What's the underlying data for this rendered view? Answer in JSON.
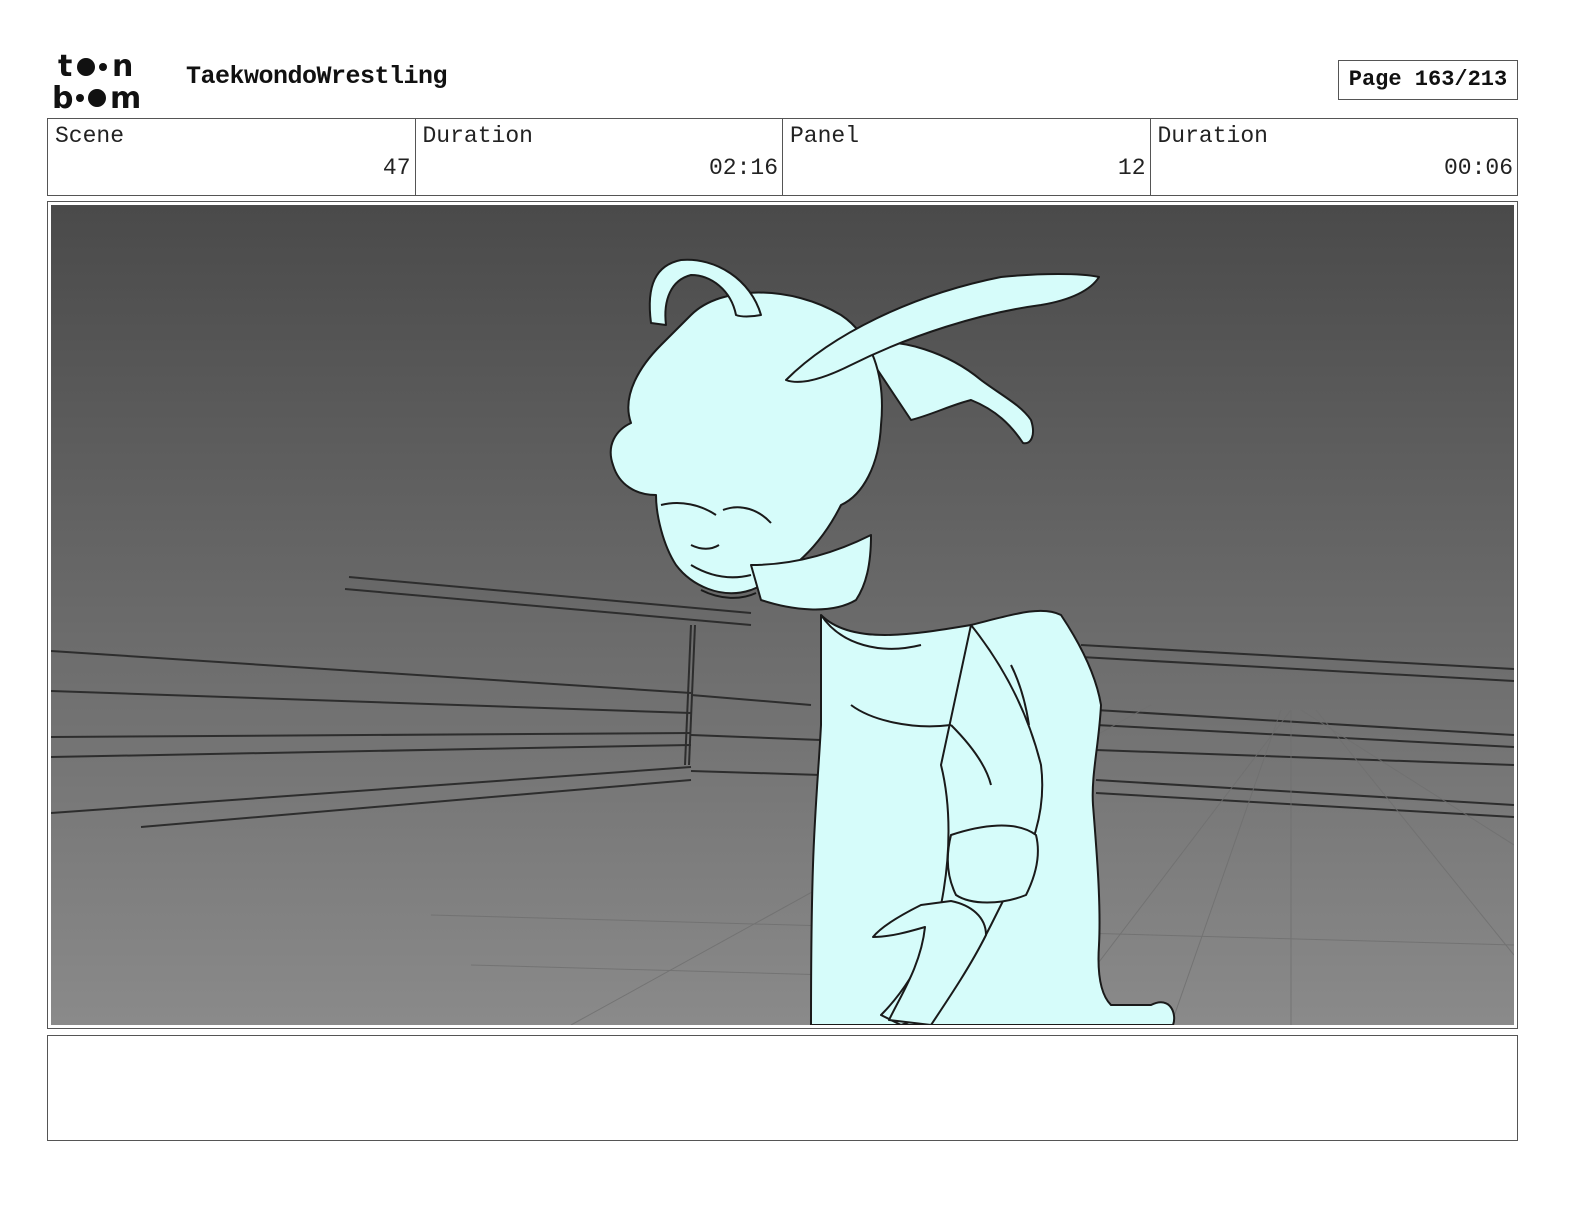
{
  "header": {
    "logo": {
      "line1": "toon",
      "line2": "boom"
    },
    "project_title": "TaekwondoWrestling",
    "page_label": "Page 163/213"
  },
  "info": {
    "scene_label": "Scene",
    "scene_value": "47",
    "scene_duration_label": "Duration",
    "scene_duration_value": "02:16",
    "panel_label": "Panel",
    "panel_value": "12",
    "panel_duration_label": "Duration",
    "panel_duration_value": "00:06"
  },
  "panel": {
    "background_top": "#4a4a4a",
    "background_bottom": "#8a8a8a",
    "character_fill": "#d6fcfa"
  },
  "notes": {
    "text": ""
  }
}
